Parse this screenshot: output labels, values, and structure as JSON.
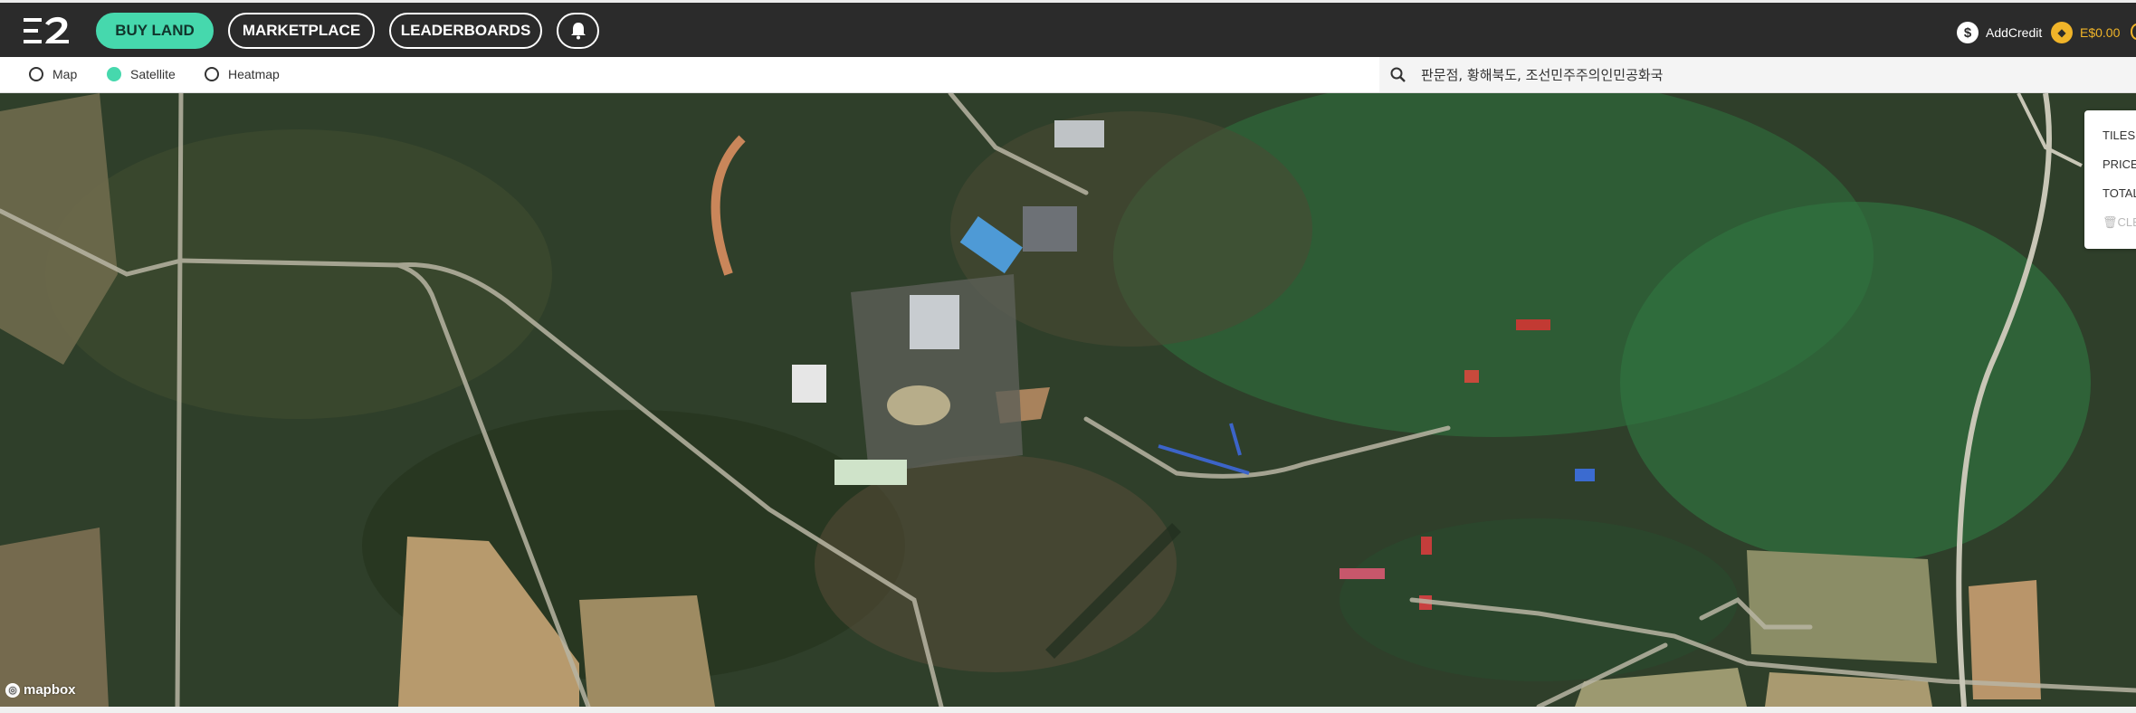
{
  "nav": {
    "buy_land": "BUY LAND",
    "marketplace": "MARKETPLACE",
    "leaderboards": "LEADERBOARDS",
    "bell_icon": "bell-icon",
    "add_credit": "AddCredit",
    "balance": "E$0.00"
  },
  "map_modes": {
    "options": [
      "Map",
      "Satellite",
      "Heatmap"
    ],
    "selected": "Satellite"
  },
  "search": {
    "value": "판문점, 황해북도, 조선민주주의인민공화국",
    "icon": "search-icon"
  },
  "info_panel": {
    "tiles": "TILES",
    "price": "PRICE",
    "total": "TOTAL",
    "clear": "CLE"
  },
  "map": {
    "attribution": "mapbox"
  },
  "colors": {
    "accent": "#46d8ad",
    "topbar": "#2b2b2b",
    "coin": "#f0b429"
  }
}
